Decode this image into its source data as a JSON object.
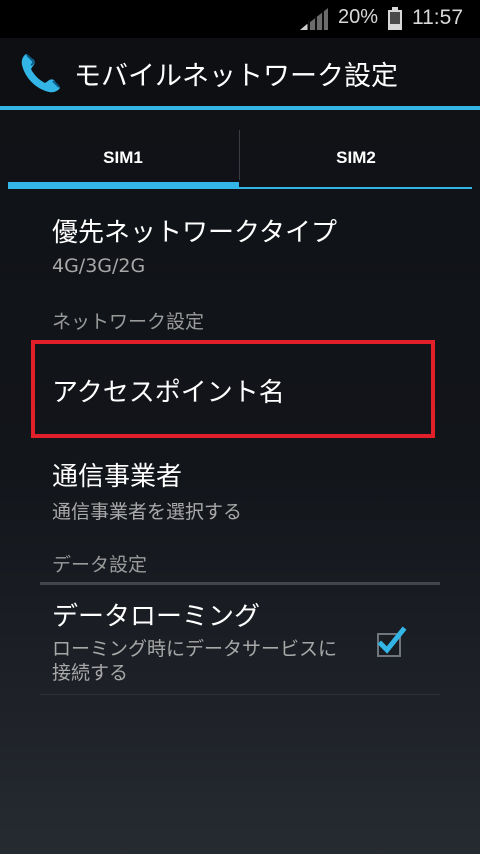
{
  "status_bar": {
    "battery_percent": "20%",
    "time": "11:57"
  },
  "action_bar": {
    "title": "モバイルネットワーク設定"
  },
  "tabs": [
    {
      "label": "SIM1",
      "selected": true
    },
    {
      "label": "SIM2",
      "selected": false
    }
  ],
  "preferences": {
    "preferred_network": {
      "title": "優先ネットワークタイプ",
      "summary": "4G/3G/2G"
    },
    "network_category": "ネットワーク設定",
    "apn": {
      "title": "アクセスポイント名"
    },
    "carrier": {
      "title": "通信事業者",
      "summary": "通信事業者を選択する"
    },
    "data_category": "データ設定",
    "data_roaming": {
      "title": "データローミング",
      "summary": "ローミング時にデータサービスに接続する",
      "checked": true
    }
  },
  "colors": {
    "accent": "#33b5e5",
    "highlight": "#e2202a"
  }
}
